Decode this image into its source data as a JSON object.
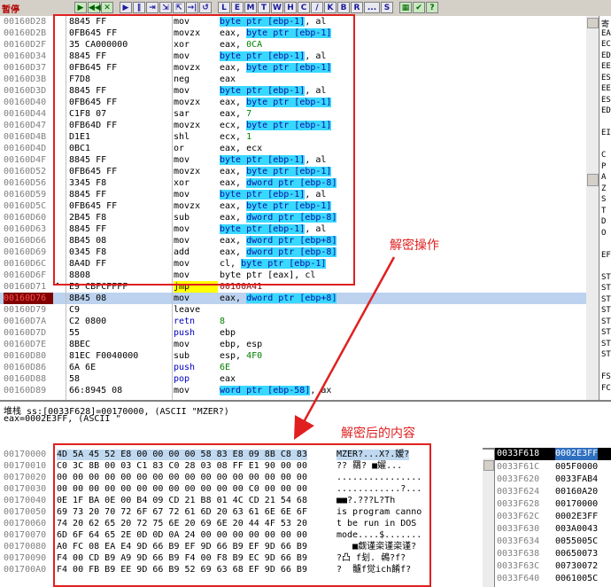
{
  "toolbar": {
    "state": "暂停",
    "buttons": [
      "▶",
      "◀◀",
      "✕",
      "",
      "▶",
      "‖",
      "⇥",
      "⇲",
      "⇱",
      "→|",
      "↺",
      "",
      "L",
      "E",
      "M",
      "T",
      "W",
      "H",
      "C",
      "/",
      "K",
      "B",
      "R",
      "...",
      "S",
      "",
      "▦",
      "✔",
      "?"
    ]
  },
  "disasm": {
    "rows": [
      {
        "addr": "00160D28",
        "mark": "",
        "hex": "8845 FF",
        "mn": "mov",
        "op": [
          [
            "byte ptr [ebp-1]",
            "hl"
          ],
          [
            ", al",
            ""
          ]
        ]
      },
      {
        "addr": "00160D2B",
        "mark": "",
        "hex": "0FB645 FF",
        "mn": "movzx",
        "op": [
          [
            "eax, ",
            ""
          ],
          [
            "byte ptr [ebp-1]",
            "hl"
          ]
        ]
      },
      {
        "addr": "00160D2F",
        "mark": "",
        "hex": "35 CA000000",
        "mn": "xor",
        "op": [
          [
            "eax, ",
            ""
          ],
          [
            "0CA",
            "num"
          ]
        ]
      },
      {
        "addr": "00160D34",
        "mark": "",
        "hex": "8845 FF",
        "mn": "mov",
        "op": [
          [
            "byte ptr [ebp-1]",
            "hl"
          ],
          [
            ", al",
            ""
          ]
        ]
      },
      {
        "addr": "00160D37",
        "mark": "",
        "hex": "0FB645 FF",
        "mn": "movzx",
        "op": [
          [
            "eax, ",
            ""
          ],
          [
            "byte ptr [ebp-1]",
            "hl"
          ]
        ]
      },
      {
        "addr": "00160D3B",
        "mark": "",
        "hex": "F7D8",
        "mn": "neg",
        "op": [
          [
            "eax",
            ""
          ]
        ]
      },
      {
        "addr": "00160D3D",
        "mark": "",
        "hex": "8845 FF",
        "mn": "mov",
        "op": [
          [
            "byte ptr [ebp-1]",
            "hl"
          ],
          [
            ", al",
            ""
          ]
        ]
      },
      {
        "addr": "00160D40",
        "mark": "",
        "hex": "0FB645 FF",
        "mn": "movzx",
        "op": [
          [
            "eax, ",
            ""
          ],
          [
            "byte ptr [ebp-1]",
            "hl"
          ]
        ]
      },
      {
        "addr": "00160D44",
        "mark": "",
        "hex": "C1F8 07",
        "mn": "sar",
        "op": [
          [
            "eax, ",
            ""
          ],
          [
            "7",
            "num"
          ]
        ]
      },
      {
        "addr": "00160D47",
        "mark": "",
        "hex": "0FB64D FF",
        "mn": "movzx",
        "op": [
          [
            "ecx, ",
            ""
          ],
          [
            "byte ptr [ebp-1]",
            "hl"
          ]
        ]
      },
      {
        "addr": "00160D4B",
        "mark": "",
        "hex": "D1E1",
        "mn": "shl",
        "op": [
          [
            "ecx, ",
            ""
          ],
          [
            "1",
            "num"
          ]
        ]
      },
      {
        "addr": "00160D4D",
        "mark": "",
        "hex": "0BC1",
        "mn": "or",
        "op": [
          [
            "eax, ecx",
            ""
          ]
        ]
      },
      {
        "addr": "00160D4F",
        "mark": "",
        "hex": "8845 FF",
        "mn": "mov",
        "op": [
          [
            "byte ptr [ebp-1]",
            "hl"
          ],
          [
            ", al",
            ""
          ]
        ]
      },
      {
        "addr": "00160D52",
        "mark": "",
        "hex": "0FB645 FF",
        "mn": "movzx",
        "op": [
          [
            "eax, ",
            ""
          ],
          [
            "byte ptr [ebp-1]",
            "hl"
          ]
        ]
      },
      {
        "addr": "00160D56",
        "mark": "",
        "hex": "3345 F8",
        "mn": "xor",
        "op": [
          [
            "eax, ",
            ""
          ],
          [
            "dword ptr [ebp-8]",
            "hl"
          ]
        ]
      },
      {
        "addr": "00160D59",
        "mark": "",
        "hex": "8845 FF",
        "mn": "mov",
        "op": [
          [
            "byte ptr [ebp-1]",
            "hl"
          ],
          [
            ", al",
            ""
          ]
        ]
      },
      {
        "addr": "00160D5C",
        "mark": "",
        "hex": "0FB645 FF",
        "mn": "movzx",
        "op": [
          [
            "eax, ",
            ""
          ],
          [
            "byte ptr [ebp-1]",
            "hl"
          ]
        ]
      },
      {
        "addr": "00160D60",
        "mark": "",
        "hex": "2B45 F8",
        "mn": "sub",
        "op": [
          [
            "eax, ",
            ""
          ],
          [
            "dword ptr [ebp-8]",
            "hl"
          ]
        ]
      },
      {
        "addr": "00160D63",
        "mark": "",
        "hex": "8845 FF",
        "mn": "mov",
        "op": [
          [
            "byte ptr [ebp-1]",
            "hl"
          ],
          [
            ", al",
            ""
          ]
        ]
      },
      {
        "addr": "00160D66",
        "mark": "",
        "hex": "8B45 08",
        "mn": "mov",
        "op": [
          [
            "eax, ",
            ""
          ],
          [
            "dword ptr [ebp+8]",
            "hl"
          ]
        ]
      },
      {
        "addr": "00160D69",
        "mark": "",
        "hex": "0345 F8",
        "mn": "add",
        "op": [
          [
            "eax, ",
            ""
          ],
          [
            "dword ptr [ebp-8]",
            "hl"
          ]
        ]
      },
      {
        "addr": "00160D6C",
        "mark": "",
        "hex": "8A4D FF",
        "mn": "mov",
        "op": [
          [
            "cl, ",
            ""
          ],
          [
            "byte ptr [ebp-1]",
            "hl"
          ]
        ]
      },
      {
        "addr": "00160D6F",
        "mark": "",
        "hex": "8808",
        "mn": "mov",
        "op": [
          [
            "byte ptr [eax], cl",
            ""
          ]
        ]
      },
      {
        "addr": "00160D71",
        "mark": "^",
        "hex": "E9 CBFCFFFF",
        "mn": "jmp",
        "op": [
          [
            "00160A41",
            "addr"
          ]
        ]
      },
      {
        "addr": "00160D76",
        "mark": "",
        "hex": "8B45 08",
        "mn": "mov",
        "op": [
          [
            "eax, ",
            ""
          ],
          [
            "dword ptr [ebp+8]",
            "hl"
          ]
        ]
      },
      {
        "addr": "00160D79",
        "mark": "",
        "hex": "C9",
        "mn": "leave",
        "op": []
      },
      {
        "addr": "00160D7A",
        "mark": "",
        "hex": "C2 0800",
        "mn": "retn",
        "op": [
          [
            "8",
            "num"
          ]
        ]
      },
      {
        "addr": "00160D7D",
        "mark": "",
        "hex": "55",
        "mn": "push",
        "op": [
          [
            "ebp",
            ""
          ]
        ]
      },
      {
        "addr": "00160D7E",
        "mark": "",
        "hex": "8BEC",
        "mn": "mov",
        "op": [
          [
            "ebp, esp",
            ""
          ]
        ]
      },
      {
        "addr": "00160D80",
        "mark": "",
        "hex": "81EC F0040000",
        "mn": "sub",
        "op": [
          [
            "esp, ",
            ""
          ],
          [
            "4F0",
            "num"
          ]
        ]
      },
      {
        "addr": "00160D86",
        "mark": "",
        "hex": "6A 6E",
        "mn": "push",
        "op": [
          [
            "6E",
            "num"
          ]
        ]
      },
      {
        "addr": "00160D88",
        "mark": "",
        "hex": "58",
        "mn": "pop",
        "op": [
          [
            "eax",
            ""
          ]
        ]
      },
      {
        "addr": "00160D89",
        "mark": "",
        "hex": "66:8945 08",
        "mn": "mov",
        "op": [
          [
            "word ptr [ebp-58]",
            "hl"
          ],
          [
            ", ax",
            ""
          ]
        ]
      }
    ],
    "selected_index": 24
  },
  "registers": [
    "寄",
    "EA",
    "EC",
    "ED",
    "EE",
    "ES",
    "EE",
    "ES",
    "ED",
    "",
    "EI",
    "",
    "C",
    "P",
    "A",
    "Z",
    "S",
    "T",
    "D",
    "O",
    "",
    "EF",
    "",
    "ST",
    "ST",
    "ST",
    "ST",
    "ST",
    "ST",
    "ST",
    "ST",
    "",
    "FS",
    "FC"
  ],
  "info": {
    "line1": "堆栈 ss:[0033F628]=00170000, (ASCII \"MZER?)",
    "line2": "eax=0002E3FF, (ASCII \""
  },
  "dump": {
    "rows": [
      {
        "addr": "00170000",
        "hex": "4D 5A 45 52 E8 00 00 00 00 58 83 E8 09 8B C8 83",
        "ascii": "MZER?...X?.嫒?"
      },
      {
        "addr": "00170010",
        "hex": "C0 3C 8B 00 03 C1 83 C0 28 03 08 FF E1 90 00 00",
        "ascii": "?? 羂? ■嬥..."
      },
      {
        "addr": "00170020",
        "hex": "00 00 00 00 00 00 00 00 00 00 00 00 00 00 00 00",
        "ascii": "................"
      },
      {
        "addr": "00170030",
        "hex": "00 00 00 00 00 00 00 00 00 00 00 00 C0 00 00 00",
        "ascii": "............?..."
      },
      {
        "addr": "00170040",
        "hex": "0E 1F BA 0E 00 B4 09 CD 21 B8 01 4C CD 21 54 68",
        "ascii": "■■?.???L?Th"
      },
      {
        "addr": "00170050",
        "hex": "69 73 20 70 72 6F 67 72 61 6D 20 63 61 6E 6E 6F",
        "ascii": "is program canno"
      },
      {
        "addr": "00170060",
        "hex": "74 20 62 65 20 72 75 6E 20 69 6E 20 44 4F 53 20",
        "ascii": "t be run in DOS "
      },
      {
        "addr": "00170070",
        "hex": "6D 6F 64 65 2E 0D 0D 0A 24 00 00 00 00 00 00 00",
        "ascii": "mode....$......."
      },
      {
        "addr": "00170080",
        "hex": "A0 FC 08 EA E4 9D 66 B9 EF 9D 66 B9 EF 9D 66 B9",
        "ascii": "   ■觑谨栥谨栥谨?"
      },
      {
        "addr": "00170090",
        "hex": "F4 00 CD B9 A9 9D 66 B9 F4 00 F8 B9 EC 9D 66 B9",
        "ascii": "?凸 f刬. 鵫?f?"
      },
      {
        "addr": "001700A0",
        "hex": "F4 00 FB B9 EE 9D 66 B9 52 69 63 68 EF 9D 66 B9",
        "ascii": "?  髗f觉ich餚f?"
      }
    ]
  },
  "stack": {
    "header": [
      "0033F618",
      "0002E3FF"
    ],
    "rows": [
      [
        "0033F61C",
        "005F0000"
      ],
      [
        "0033F620",
        "0033FAB4"
      ],
      [
        "0033F624",
        "00160A20"
      ],
      [
        "0033F628",
        "00170000"
      ],
      [
        "0033F62C",
        "0002E3FF"
      ],
      [
        "0033F630",
        "003A0043"
      ],
      [
        "0033F634",
        "0055005C"
      ],
      [
        "0033F638",
        "00650073"
      ],
      [
        "0033F63C",
        "00730072"
      ],
      [
        "0033F640",
        "0061005C"
      ]
    ]
  },
  "annotations": {
    "decrypt_op": "解密操作",
    "decrypted_content": "解密后的内容"
  },
  "colors": {
    "annotation_red": "#e02020",
    "operand_highlight": "#38d8ff",
    "selected_row": "#bcd2ee",
    "eip_address": "#800000"
  }
}
